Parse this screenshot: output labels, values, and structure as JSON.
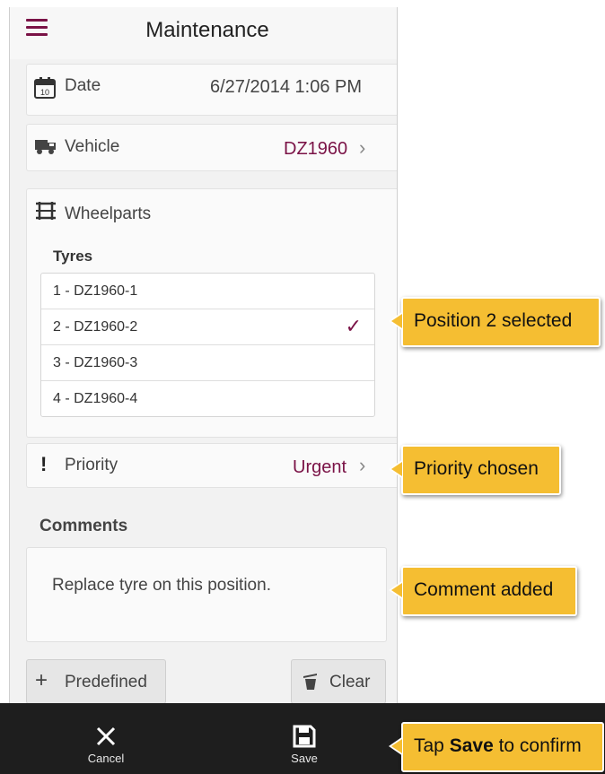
{
  "header": {
    "title": "Maintenance"
  },
  "date": {
    "label": "Date",
    "value": "6/27/2014 1:06 PM",
    "calendar_day": "10"
  },
  "vehicle": {
    "label": "Vehicle",
    "value": "DZ1960"
  },
  "wheelparts": {
    "label": "Wheelparts",
    "section_title": "Tyres",
    "tyres": [
      {
        "label": "1 - DZ1960-1",
        "selected": false
      },
      {
        "label": "2 - DZ1960-2",
        "selected": true
      },
      {
        "label": "3 - DZ1960-3",
        "selected": false
      },
      {
        "label": "4 - DZ1960-4",
        "selected": false
      }
    ]
  },
  "priority": {
    "label": "Priority",
    "value": "Urgent",
    "icon_glyph": "!"
  },
  "comments": {
    "title": "Comments",
    "text": "Replace tyre on this position."
  },
  "buttons": {
    "predefined": "Predefined",
    "clear": "Clear"
  },
  "footer": {
    "cancel": "Cancel",
    "save": "Save"
  },
  "callouts": {
    "position": "Position 2 selected",
    "priority": "Priority chosen",
    "comment": "Comment added",
    "save_prefix": "Tap ",
    "save_bold": "Save",
    "save_suffix": " to confirm"
  },
  "colors": {
    "accent": "#7a1246",
    "callout": "#f5be32",
    "footer": "#1e1e1e"
  }
}
